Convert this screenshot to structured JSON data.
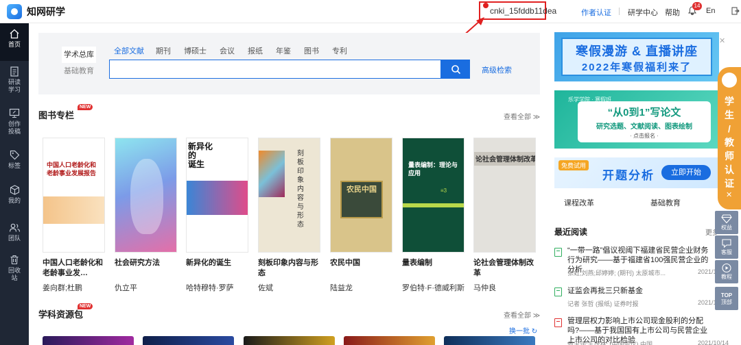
{
  "header": {
    "logo_text": "知网研学",
    "user_name": "cnki_15fddb11dea",
    "author_cert": "作者认证",
    "study_center": "研学中心",
    "help": "帮助",
    "notification_count": "14",
    "language": "En"
  },
  "sidebar": {
    "items": [
      {
        "label": "首页"
      },
      {
        "label": "研读\n学习"
      },
      {
        "label": "创作\n投稿"
      },
      {
        "label": "标签"
      },
      {
        "label": "我的"
      },
      {
        "label": "团队"
      },
      {
        "label": "回收\n站"
      }
    ]
  },
  "search": {
    "db_tabs": [
      "学术总库",
      "基础教育"
    ],
    "source_tabs": [
      "全部文献",
      "期刊",
      "博硕士",
      "会议",
      "报纸",
      "年鉴",
      "图书",
      "专利"
    ],
    "placeholder": "",
    "advanced": "高级检索"
  },
  "books_section": {
    "title": "图书专栏",
    "new_badge": "NEW",
    "view_all": "查看全部 ≫",
    "books": [
      {
        "title": "中国人口老龄化和老龄事业发…",
        "author": "姜向群;杜鹏",
        "cover_text": "中国人口老龄化和\n老龄事业发展报告"
      },
      {
        "title": "社会研究方法",
        "author": "仇立平",
        "cover_text": ""
      },
      {
        "title": "新异化的诞生",
        "author": "哈特穆特·罗萨",
        "cover_text": "新异化\n的\n诞生"
      },
      {
        "title": "刻板印象内容与形态",
        "author": "佐斌",
        "cover_text": "刻板印象内容与形态"
      },
      {
        "title": "农民中国",
        "author": "陆益龙",
        "cover_text": "农民中国"
      },
      {
        "title": "量表编制",
        "author": "罗伯特·F·德威利斯",
        "cover_text": "量表编制：理论与应用"
      },
      {
        "title": "论社会管理体制改革",
        "author": "马仲良",
        "cover_text": "论社会管理体制改革"
      }
    ]
  },
  "resources_section": {
    "title": "学科资源包",
    "new_badge": "NEW",
    "view_all": "查看全部 ≫",
    "swap": "换一批 ↻"
  },
  "right": {
    "banner1": {
      "line1": "寒假漫游 & 直播讲座",
      "line2": "2022年寒假福利来了"
    },
    "banner2": {
      "tag": "乐学学院 · 寒假班",
      "line1": "“从0到1”写论文",
      "line2": "研究选题、文献阅读、图表绘制",
      "line3": "· 点击报名 ·"
    },
    "banner3": {
      "free": "免费试用",
      "main": "开题分析",
      "button": "立即开始"
    },
    "tabs": [
      "课程改革",
      "基础教育"
    ],
    "recent_title": "最近阅读",
    "recent_more": "更多",
    "recent": [
      {
        "title": "“一带一路”倡议视阈下福建省民营企业财务行为研究——基于福建省100强民营企业的分析",
        "meta": "张虹;刘燕;邱婷婷;  (期刊) 太原城市...",
        "date": "2021/10",
        "icon": "green"
      },
      {
        "title": "证监会再批三只新基金",
        "meta": "记者 张哲        (报纸) 证券时报",
        "date": "2021/10",
        "icon": "green"
      },
      {
        "title": "管理层权力影响上市公司现金股利的分配吗?——基于我国国有上市公司与民营企业上市公司的对比检验",
        "meta": "何玉润;王茂林;   (中国会议) 中国...",
        "date": "2021/10/14",
        "icon": "red"
      }
    ]
  },
  "floating": {
    "badge_text": "学\n生\n/\n教\n师\n认\n证",
    "buttons": [
      "权益",
      "客服",
      "教程",
      "顶部"
    ],
    "top_label": "TOP"
  },
  "colors": {
    "primary": "#1a6de0",
    "sidebar": "#1f2735",
    "badge_red": "#e03030",
    "orange": "#f0a135"
  }
}
